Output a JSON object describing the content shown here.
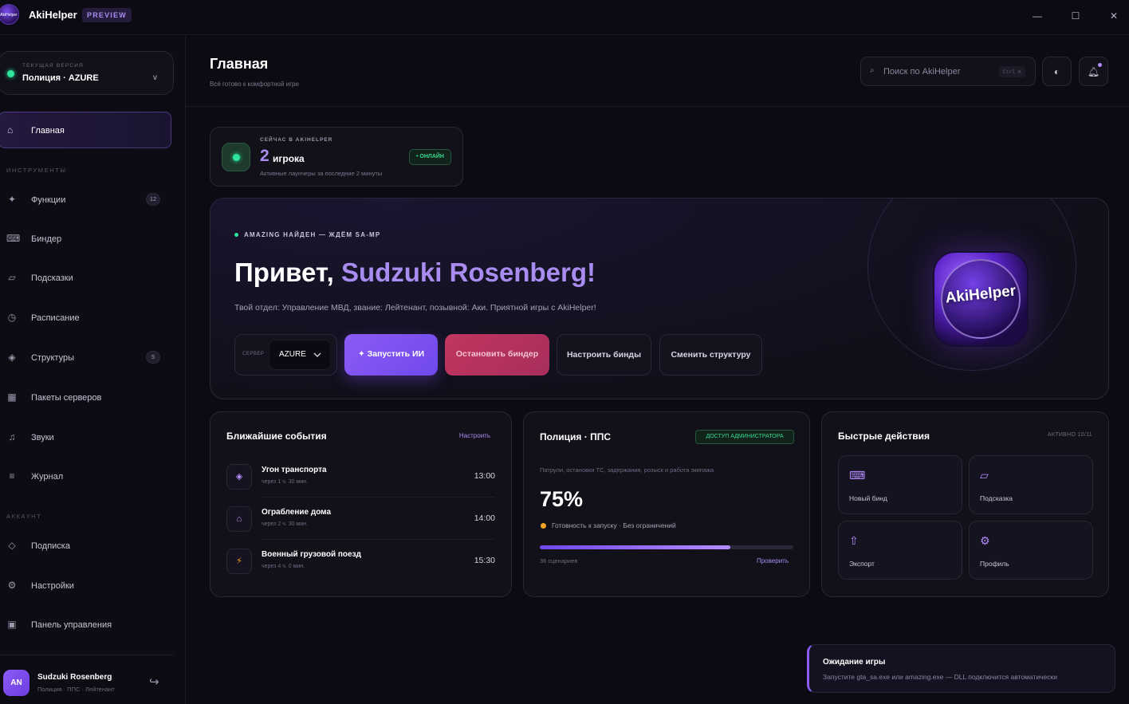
{
  "app": {
    "title": "AkiHelper",
    "badge": "PREVIEW",
    "logo_text": "AkiHelper"
  },
  "window": {
    "minimize": "—",
    "maximize": "☐",
    "close": "✕"
  },
  "sidebar": {
    "version_caption": "ТЕКУЩАЯ ВЕРСИЯ",
    "version_value": "Полиция · AZURE",
    "home_label": "Главная",
    "tools_section": "ИНСТРУМЕНТЫ",
    "tools": [
      {
        "label": "Функции",
        "icon": "sparkle-icon",
        "count": "12"
      },
      {
        "label": "Биндер",
        "icon": "keyboard-icon"
      },
      {
        "label": "Подсказки",
        "icon": "card-icon"
      },
      {
        "label": "Расписание",
        "icon": "clock-icon"
      },
      {
        "label": "Структуры",
        "icon": "diamond-icon",
        "count": "5"
      },
      {
        "label": "Пакеты серверов",
        "icon": "grid-icon"
      },
      {
        "label": "Звуки",
        "icon": "music-icon"
      },
      {
        "label": "Журнал",
        "icon": "list-icon"
      }
    ],
    "account_section": "АККАУНТ",
    "account": [
      {
        "label": "Подписка",
        "icon": "diamond-outline-icon"
      },
      {
        "label": "Настройки",
        "icon": "gear-icon"
      },
      {
        "label": "Панель управления",
        "icon": "panel-icon"
      }
    ],
    "user": {
      "initials": "AN",
      "name": "Sudzuki Rosenberg",
      "role": "Полиция · ППС · Лейтенант"
    }
  },
  "header": {
    "title": "Главная",
    "subtitle": "Всё готово к комфортной игре",
    "search_placeholder": "Поиск по AkiHelper",
    "search_shortcut": "Ctrl K"
  },
  "online": {
    "caption": "СЕЙЧАС В AKIHELPER",
    "count": "2",
    "unit": "игрока",
    "description": "Активные лаунчеры за последние 2 минуты",
    "badge": "• ОНЛАЙН"
  },
  "hero": {
    "status": "AMAZING НАЙДЕН — ЖДЁМ SA-MP",
    "greeting_prefix": "Привет, ",
    "user_name": "Sudzuki Rosenberg!",
    "subtitle": "Твой отдел: Управление МВД, звание: Лейтенант, позывной: Аки. Приятной игры с AkiHelper!",
    "server_caption": "СЕРВЕР",
    "server_value": "AZURE",
    "btn_launch": "✦ Запустить ИИ",
    "btn_stop": "Остановить биндер",
    "btn_binds": "Настроить бинды",
    "btn_structure": "Сменить структуру",
    "logo_text": "AkiHelper"
  },
  "events": {
    "title": "Ближайшие события",
    "link": "Настроить",
    "items": [
      {
        "title": "Угон транспорта",
        "sub": "через 1 ч. 30 мин.",
        "time": "13:00",
        "icon": "◈"
      },
      {
        "title": "Ограбление дома",
        "sub": "через 2 ч. 30 мин.",
        "time": "14:00",
        "icon": "⌂"
      },
      {
        "title": "Военный грузовой поезд",
        "sub": "через 4 ч. 0 мин.",
        "time": "15:30",
        "icon": "⚡"
      }
    ]
  },
  "police": {
    "title": "Полиция · ППС",
    "badge": "ДОСТУП АДМИНИСТРАТОРА",
    "description": "Патрули, остановки ТС, задержания, розыск и работа экипажа",
    "percent": "75%",
    "progress": 0.75,
    "status": "Готовность к запуску · Без ограничений",
    "scenarios": "36 сценариев",
    "link": "Проверить",
    "status_color": "#f5a623"
  },
  "quick": {
    "title": "Быстрые действия",
    "status": "АКТИВНО 10/11",
    "tiles": [
      {
        "label": "Новый бинд",
        "icon": "⌨"
      },
      {
        "label": "Подсказка",
        "icon": "▱"
      },
      {
        "label": "Экспорт",
        "icon": "⇧"
      },
      {
        "label": "Профиль",
        "icon": "⚙"
      }
    ]
  },
  "toast": {
    "title": "Ожидание игры",
    "text": "Запустите gta_sa.exe или amazing.exe — DLL подключится автоматически"
  },
  "colors": {
    "accent": "#8b5cf6",
    "online": "#2ee59d",
    "background": "#0c0a12"
  }
}
